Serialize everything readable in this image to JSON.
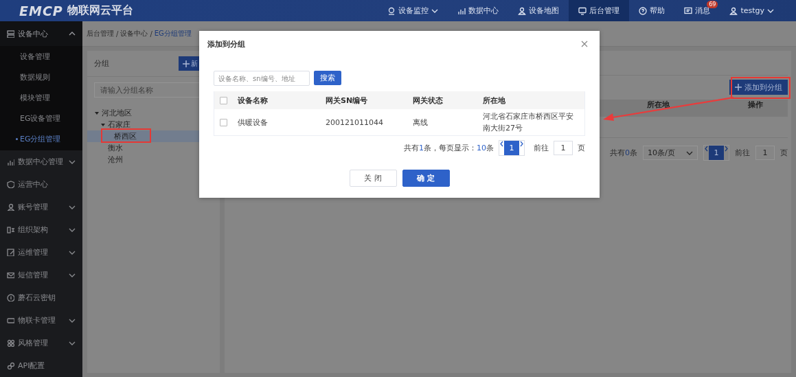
{
  "header": {
    "logo": "EMCP",
    "platform_name": "物联网云平台",
    "nav": [
      {
        "label": "设备监控",
        "dropdown": true,
        "selected": false
      },
      {
        "label": "数据中心",
        "dropdown": false,
        "selected": false
      },
      {
        "label": "设备地图",
        "dropdown": false,
        "selected": false
      },
      {
        "label": "后台管理",
        "dropdown": false,
        "selected": true
      },
      {
        "label": "帮助",
        "dropdown": false,
        "selected": false
      },
      {
        "label": "消息",
        "dropdown": false,
        "selected": false,
        "badge": "69"
      },
      {
        "label": "testgy",
        "dropdown": true,
        "selected": false
      }
    ]
  },
  "sidebar": {
    "items": [
      {
        "label": "设备中心",
        "expandable": true,
        "expanded": true,
        "children": [
          {
            "label": "设备管理",
            "selected": false
          },
          {
            "label": "数据规则",
            "selected": false
          },
          {
            "label": "模块管理",
            "selected": false
          },
          {
            "label": "EG设备管理",
            "selected": false
          },
          {
            "label": "EG分组管理",
            "selected": true
          }
        ]
      },
      {
        "label": "数据中心管理",
        "expandable": true,
        "expanded": false
      },
      {
        "label": "运营中心",
        "expandable": false,
        "expanded": false
      },
      {
        "label": "账号管理",
        "expandable": true,
        "expanded": false
      },
      {
        "label": "组织架构",
        "expandable": true,
        "expanded": false
      },
      {
        "label": "运维管理",
        "expandable": true,
        "expanded": false
      },
      {
        "label": "短信管理",
        "expandable": true,
        "expanded": false
      },
      {
        "label": "蘑石云密钥",
        "expandable": false,
        "expanded": false
      },
      {
        "label": "物联卡管理",
        "expandable": true,
        "expanded": false
      },
      {
        "label": "风格管理",
        "expandable": true,
        "expanded": false
      },
      {
        "label": "API配置",
        "expandable": false,
        "expanded": false
      }
    ]
  },
  "breadcrumb": {
    "separator": "/",
    "items": [
      "后台管理",
      "设备中心",
      "EG分组管理"
    ]
  },
  "group_panel": {
    "title": "分组",
    "new_button": "新",
    "search_placeholder": "请输入分组名称",
    "tree": [
      {
        "label": "河北地区",
        "expanded": true,
        "selected": false,
        "children": [
          {
            "label": "石家庄",
            "expanded": true,
            "selected": false,
            "children": [
              {
                "label": "桥西区",
                "selected": true
              }
            ]
          },
          {
            "label": "衡水",
            "selected": false
          },
          {
            "label": "沧州",
            "selected": false
          }
        ]
      }
    ]
  },
  "device_panel": {
    "add_button": "添加到分组",
    "columns": [
      "所在地",
      "操作"
    ],
    "pagination": {
      "total_prefix": "共有",
      "total": "0",
      "total_suffix": "条",
      "page_size": "10条/页",
      "current_page": "1",
      "goto_label": "前往",
      "goto_value": "1",
      "page_unit": "页"
    }
  },
  "modal": {
    "title": "添加到分组",
    "search": {
      "placeholder": "设备名称、sn编号、地址",
      "button": "搜索"
    },
    "table": {
      "header_checked": false,
      "columns": [
        "设备名称",
        "网关SN编号",
        "网关状态",
        "所在地"
      ],
      "rows": [
        {
          "checked": false,
          "cells": [
            "供暖设备",
            "200121011044",
            "离线",
            "河北省石家庄市桥西区平安南大街27号"
          ]
        }
      ]
    },
    "pagination": {
      "total_prefix": "共有",
      "total": "1",
      "total_middle": "条，每页显示：",
      "page_size": "10",
      "page_size_suffix": "条",
      "current_page": "1",
      "goto_label": "前往",
      "goto_value": "1",
      "page_unit": "页"
    },
    "buttons": [
      {
        "label": "关 闭",
        "kind": "default"
      },
      {
        "label": "确 定",
        "kind": "primary"
      }
    ]
  }
}
